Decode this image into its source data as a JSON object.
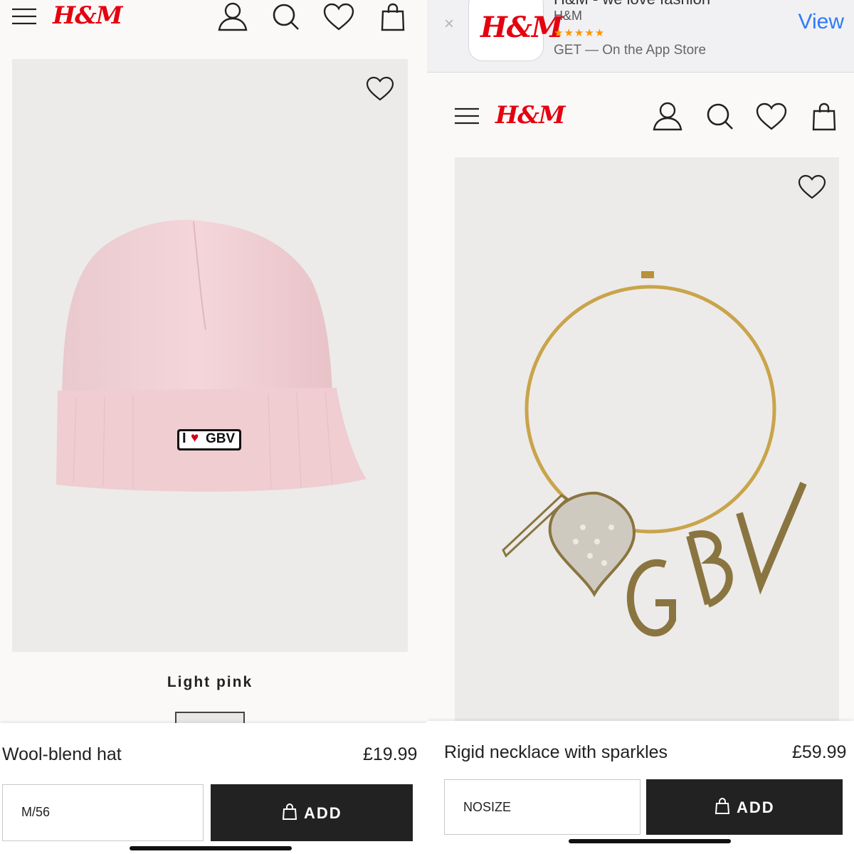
{
  "brand": {
    "logo_text": "H&M",
    "brand_red": "#e50010"
  },
  "header_icons": [
    "menu-icon",
    "account-icon",
    "search-icon",
    "favourites-icon",
    "shopping-bag-icon"
  ],
  "left": {
    "product_name": "Wool-blend hat",
    "price": "£19.99",
    "color_label": "Light pink",
    "size": "M/56",
    "add_label": "ADD",
    "hat_patch_text": "I",
    "hat_patch_text2": "GBV"
  },
  "right": {
    "app_banner": {
      "title": "H&M - we love fashion",
      "developer": "H&M",
      "stars": "★★★★★",
      "store_text": "GET — On the App Store",
      "view_label": "View",
      "close_label": "×"
    },
    "product_name": "Rigid necklace with sparkles",
    "price": "£59.99",
    "size": "NOSIZE",
    "add_label": "ADD",
    "pendants": [
      "I",
      "G",
      "B",
      "V"
    ]
  }
}
